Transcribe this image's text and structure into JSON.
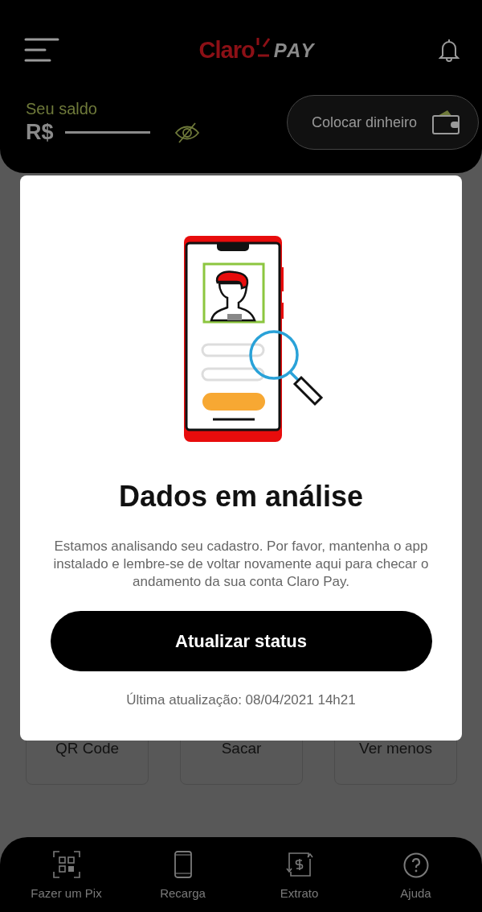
{
  "header": {
    "logo": {
      "brand": "Claro",
      "suffix": "PAY"
    },
    "balance": {
      "label": "Seu saldo",
      "currency": "R$"
    },
    "add_money_button": "Colocar dinheiro"
  },
  "tiles": [
    {
      "label": "QR Code"
    },
    {
      "label": "Sacar"
    },
    {
      "label": "Ver menos"
    }
  ],
  "modal": {
    "title": "Dados em análise",
    "message": "Estamos analisando seu cadastro. Por favor, mantenha o app instalado e lembre-se de voltar novamente aqui para checar o andamento da sua conta Claro Pay.",
    "button": "Atualizar status",
    "last_update": "Última atualização: 08/04/2021 14h21"
  },
  "bottom_nav": [
    {
      "kind": "qr",
      "label": "Fazer um Pix"
    },
    {
      "kind": "phone",
      "label": "Recarga"
    },
    {
      "kind": "statement",
      "label": "Extrato"
    },
    {
      "kind": "help",
      "label": "Ajuda"
    }
  ]
}
